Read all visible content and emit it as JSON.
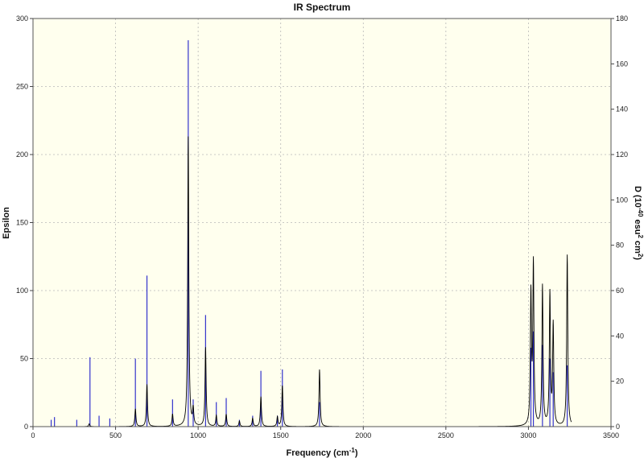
{
  "chart_data": {
    "type": "line",
    "title": "IR Spectrum",
    "xlabel": "Frequency (cm",
    "xlabel_sup": "-1",
    "xlabel_end": ")",
    "ylabel": "Epsilon",
    "y2label_pre": "D (10",
    "y2label_sup1": "-40",
    "y2label_mid": " esu",
    "y2label_sup2": "2",
    "y2label_mid2": " cm",
    "y2label_sup3": "2",
    "y2label_end": ")",
    "xlim": [
      0,
      3500
    ],
    "ylim": [
      0,
      300
    ],
    "y2lim": [
      0,
      180
    ],
    "x_ticks": [
      0,
      500,
      1000,
      1500,
      2000,
      2500,
      3000,
      3500
    ],
    "y_ticks": [
      0,
      50,
      100,
      150,
      200,
      250,
      300
    ],
    "y2_ticks": [
      0,
      20,
      40,
      60,
      80,
      100,
      120,
      140,
      160,
      180
    ],
    "grid": true,
    "colors": {
      "plot_background": "#ffffee",
      "spectrum_line": "#000000",
      "stick_bars": "#3333cc",
      "grid": "#b8b8b8"
    },
    "series": [
      {
        "kind": "spectrum",
        "peaks": [
          {
            "x": 340,
            "y": 2
          },
          {
            "x": 620,
            "y": 13
          },
          {
            "x": 690,
            "y": 31
          },
          {
            "x": 845,
            "y": 9
          },
          {
            "x": 940,
            "y": 213
          },
          {
            "x": 970,
            "y": 12
          },
          {
            "x": 1045,
            "y": 58
          },
          {
            "x": 1110,
            "y": 8
          },
          {
            "x": 1170,
            "y": 9
          },
          {
            "x": 1250,
            "y": 4
          },
          {
            "x": 1330,
            "y": 6
          },
          {
            "x": 1380,
            "y": 22
          },
          {
            "x": 1480,
            "y": 7
          },
          {
            "x": 1510,
            "y": 30
          },
          {
            "x": 1735,
            "y": 42
          },
          {
            "x": 3015,
            "y": 96
          },
          {
            "x": 3030,
            "y": 118
          },
          {
            "x": 3085,
            "y": 103
          },
          {
            "x": 3130,
            "y": 97
          },
          {
            "x": 3150,
            "y": 74
          },
          {
            "x": 3235,
            "y": 126
          }
        ]
      },
      {
        "kind": "sticks",
        "points": [
          {
            "x": 110,
            "y": 5
          },
          {
            "x": 130,
            "y": 7
          },
          {
            "x": 265,
            "y": 5
          },
          {
            "x": 345,
            "y": 51
          },
          {
            "x": 400,
            "y": 8
          },
          {
            "x": 465,
            "y": 6
          },
          {
            "x": 620,
            "y": 50
          },
          {
            "x": 690,
            "y": 111
          },
          {
            "x": 845,
            "y": 20
          },
          {
            "x": 940,
            "y": 284
          },
          {
            "x": 970,
            "y": 20
          },
          {
            "x": 1045,
            "y": 82
          },
          {
            "x": 1110,
            "y": 18
          },
          {
            "x": 1170,
            "y": 21
          },
          {
            "x": 1250,
            "y": 5
          },
          {
            "x": 1330,
            "y": 8
          },
          {
            "x": 1380,
            "y": 41
          },
          {
            "x": 1480,
            "y": 8
          },
          {
            "x": 1510,
            "y": 42
          },
          {
            "x": 1735,
            "y": 18
          },
          {
            "x": 3015,
            "y": 58
          },
          {
            "x": 3030,
            "y": 70
          },
          {
            "x": 3085,
            "y": 60
          },
          {
            "x": 3130,
            "y": 50
          },
          {
            "x": 3150,
            "y": 40
          },
          {
            "x": 3235,
            "y": 45
          }
        ]
      }
    ]
  }
}
